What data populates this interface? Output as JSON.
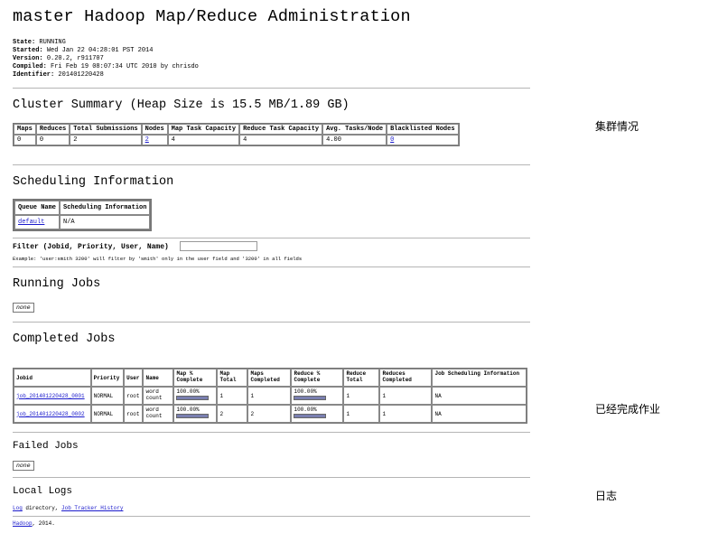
{
  "page": {
    "title": "master Hadoop Map/Reduce Administration",
    "info": [
      {
        "label": "State:",
        "value": "RUNNING"
      },
      {
        "label": "Started:",
        "value": "Wed Jan 22 04:28:01 PST 2014"
      },
      {
        "label": "Version:",
        "value": "0.20.2, r911707"
      },
      {
        "label": "Compiled:",
        "value": "Fri Feb 19 08:07:34 UTC 2010 by chrisdo"
      },
      {
        "label": "Identifier:",
        "value": "201401220428"
      }
    ]
  },
  "cluster": {
    "heading": "Cluster Summary (Heap Size is 15.5 MB/1.89 GB)",
    "headers": [
      "Maps",
      "Reduces",
      "Total Submissions",
      "Nodes",
      "Map Task Capacity",
      "Reduce Task Capacity",
      "Avg. Tasks/Node",
      "Blacklisted Nodes"
    ],
    "values": [
      "0",
      "0",
      "2",
      "2",
      "4",
      "4",
      "4.00",
      "0"
    ]
  },
  "scheduling": {
    "heading": "Scheduling Information",
    "headers": [
      "Queue Name",
      "Scheduling Information"
    ],
    "row": [
      "default",
      "N/A"
    ]
  },
  "filter": {
    "label": "Filter (Jobid, Priority, User, Name)",
    "value": "",
    "example": "Example: 'user:smith 3200' will filter by 'smith' only in the user field and '3200' in all fields"
  },
  "running": {
    "heading": "Running Jobs",
    "none": "none"
  },
  "completed": {
    "heading": "Completed Jobs",
    "headers": [
      "Jobid",
      "Priority",
      "User",
      "Name",
      "Map % Complete",
      "Map Total",
      "Maps Completed",
      "Reduce % Complete",
      "Reduce Total",
      "Reduces Completed",
      "Job Scheduling Information"
    ],
    "rows": [
      {
        "jobid": "job_201401220428_0001",
        "priority": "NORMAL",
        "user": "root",
        "name": "word count",
        "map_pct": "100.00%",
        "map_fraction": 1.0,
        "map_total": "1",
        "maps_completed": "1",
        "reduce_pct": "100.00%",
        "reduce_fraction": 1.0,
        "reduce_total": "1",
        "reduces_completed": "1",
        "sched": "NA"
      },
      {
        "jobid": "job_201401220428_0002",
        "priority": "NORMAL",
        "user": "root",
        "name": "word count",
        "map_pct": "100.00%",
        "map_fraction": 1.0,
        "map_total": "2",
        "maps_completed": "2",
        "reduce_pct": "100.00%",
        "reduce_fraction": 1.0,
        "reduce_total": "1",
        "reduces_completed": "1",
        "sched": "NA"
      }
    ]
  },
  "failed": {
    "heading": "Failed Jobs",
    "none": "none"
  },
  "logs": {
    "heading": "Local Logs",
    "log_link": "Log",
    "log_text": " directory, ",
    "history_link": "Job Tracker History"
  },
  "footer": {
    "link": "Hadoop",
    "text": ", 2014."
  },
  "annotations": {
    "cluster": "集群情况",
    "completed": "已经完成作业",
    "logs": "日志"
  },
  "colors": {
    "link": "#1a1acc",
    "progress": "#7a7fb0"
  }
}
